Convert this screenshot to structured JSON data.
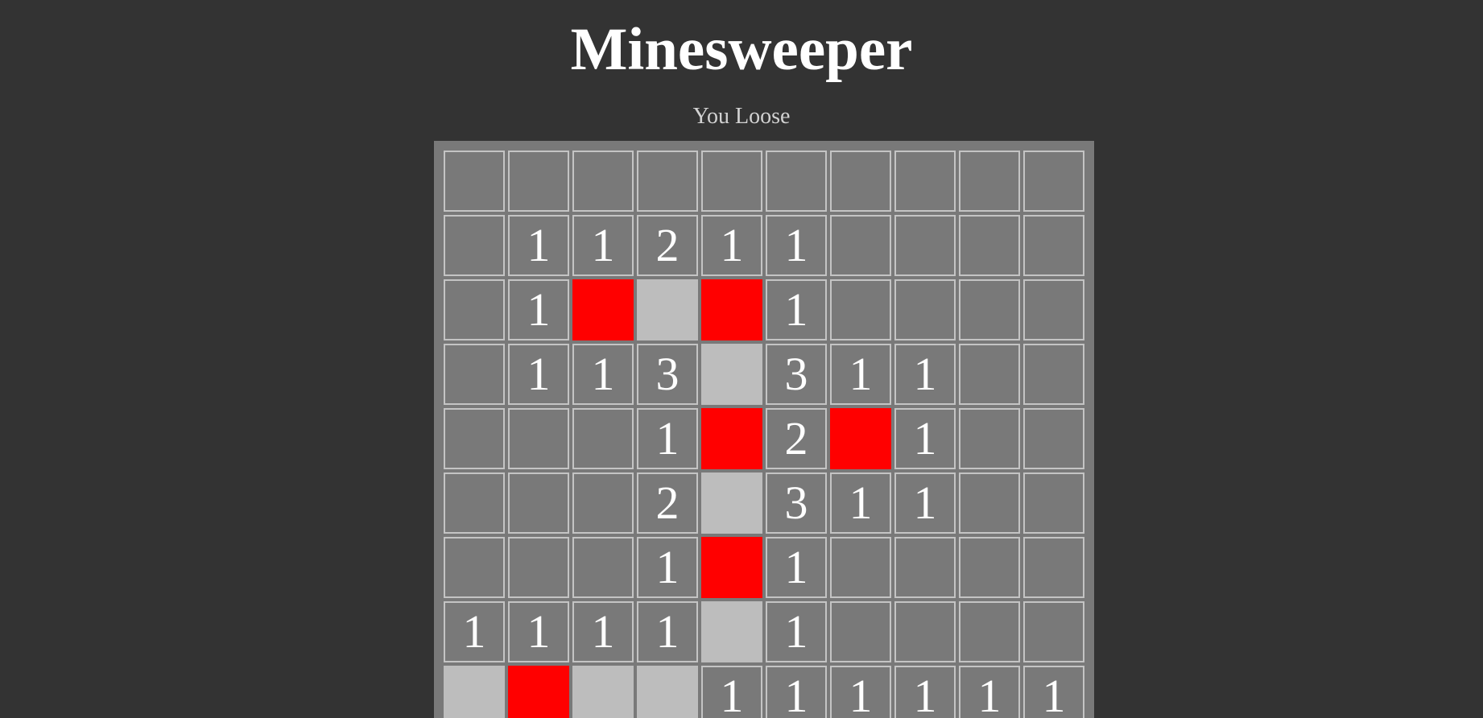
{
  "title": "Minesweeper",
  "status": "You Loose",
  "colors": {
    "background": "#333333",
    "board": "#797979",
    "revealed": "#bdbdbd",
    "mine": "#ff0000",
    "text": "#ffffff"
  },
  "board": {
    "rows": [
      [
        {
          "s": "hidden",
          "v": ""
        },
        {
          "s": "hidden",
          "v": ""
        },
        {
          "s": "hidden",
          "v": ""
        },
        {
          "s": "hidden",
          "v": ""
        },
        {
          "s": "hidden",
          "v": ""
        },
        {
          "s": "hidden",
          "v": ""
        },
        {
          "s": "hidden",
          "v": ""
        },
        {
          "s": "hidden",
          "v": ""
        },
        {
          "s": "hidden",
          "v": ""
        },
        {
          "s": "hidden",
          "v": ""
        }
      ],
      [
        {
          "s": "hidden",
          "v": ""
        },
        {
          "s": "number",
          "v": "1"
        },
        {
          "s": "number",
          "v": "1"
        },
        {
          "s": "number",
          "v": "2"
        },
        {
          "s": "number",
          "v": "1"
        },
        {
          "s": "number",
          "v": "1"
        },
        {
          "s": "hidden",
          "v": ""
        },
        {
          "s": "hidden",
          "v": ""
        },
        {
          "s": "hidden",
          "v": ""
        },
        {
          "s": "hidden",
          "v": ""
        }
      ],
      [
        {
          "s": "hidden",
          "v": ""
        },
        {
          "s": "number",
          "v": "1"
        },
        {
          "s": "mine",
          "v": ""
        },
        {
          "s": "revealed",
          "v": ""
        },
        {
          "s": "mine",
          "v": ""
        },
        {
          "s": "number",
          "v": "1"
        },
        {
          "s": "hidden",
          "v": ""
        },
        {
          "s": "hidden",
          "v": ""
        },
        {
          "s": "hidden",
          "v": ""
        },
        {
          "s": "hidden",
          "v": ""
        }
      ],
      [
        {
          "s": "hidden",
          "v": ""
        },
        {
          "s": "number",
          "v": "1"
        },
        {
          "s": "number",
          "v": "1"
        },
        {
          "s": "number",
          "v": "3"
        },
        {
          "s": "revealed",
          "v": ""
        },
        {
          "s": "number",
          "v": "3"
        },
        {
          "s": "number",
          "v": "1"
        },
        {
          "s": "number",
          "v": "1"
        },
        {
          "s": "hidden",
          "v": ""
        },
        {
          "s": "hidden",
          "v": ""
        }
      ],
      [
        {
          "s": "hidden",
          "v": ""
        },
        {
          "s": "hidden",
          "v": ""
        },
        {
          "s": "hidden",
          "v": ""
        },
        {
          "s": "number",
          "v": "1"
        },
        {
          "s": "mine",
          "v": ""
        },
        {
          "s": "number",
          "v": "2"
        },
        {
          "s": "mine",
          "v": ""
        },
        {
          "s": "number",
          "v": "1"
        },
        {
          "s": "hidden",
          "v": ""
        },
        {
          "s": "hidden",
          "v": ""
        }
      ],
      [
        {
          "s": "hidden",
          "v": ""
        },
        {
          "s": "hidden",
          "v": ""
        },
        {
          "s": "hidden",
          "v": ""
        },
        {
          "s": "number",
          "v": "2"
        },
        {
          "s": "revealed",
          "v": ""
        },
        {
          "s": "number",
          "v": "3"
        },
        {
          "s": "number",
          "v": "1"
        },
        {
          "s": "number",
          "v": "1"
        },
        {
          "s": "hidden",
          "v": ""
        },
        {
          "s": "hidden",
          "v": ""
        }
      ],
      [
        {
          "s": "hidden",
          "v": ""
        },
        {
          "s": "hidden",
          "v": ""
        },
        {
          "s": "hidden",
          "v": ""
        },
        {
          "s": "number",
          "v": "1"
        },
        {
          "s": "mine",
          "v": ""
        },
        {
          "s": "number",
          "v": "1"
        },
        {
          "s": "hidden",
          "v": ""
        },
        {
          "s": "hidden",
          "v": ""
        },
        {
          "s": "hidden",
          "v": ""
        },
        {
          "s": "hidden",
          "v": ""
        }
      ],
      [
        {
          "s": "number",
          "v": "1"
        },
        {
          "s": "number",
          "v": "1"
        },
        {
          "s": "number",
          "v": "1"
        },
        {
          "s": "number",
          "v": "1"
        },
        {
          "s": "revealed",
          "v": ""
        },
        {
          "s": "number",
          "v": "1"
        },
        {
          "s": "hidden",
          "v": ""
        },
        {
          "s": "hidden",
          "v": ""
        },
        {
          "s": "hidden",
          "v": ""
        },
        {
          "s": "hidden",
          "v": ""
        }
      ],
      [
        {
          "s": "revealed",
          "v": ""
        },
        {
          "s": "mine",
          "v": ""
        },
        {
          "s": "revealed",
          "v": ""
        },
        {
          "s": "revealed",
          "v": ""
        },
        {
          "s": "number",
          "v": "1"
        },
        {
          "s": "number",
          "v": "1"
        },
        {
          "s": "number",
          "v": "1"
        },
        {
          "s": "number",
          "v": "1"
        },
        {
          "s": "number",
          "v": "1"
        },
        {
          "s": "number",
          "v": "1"
        }
      ]
    ]
  }
}
